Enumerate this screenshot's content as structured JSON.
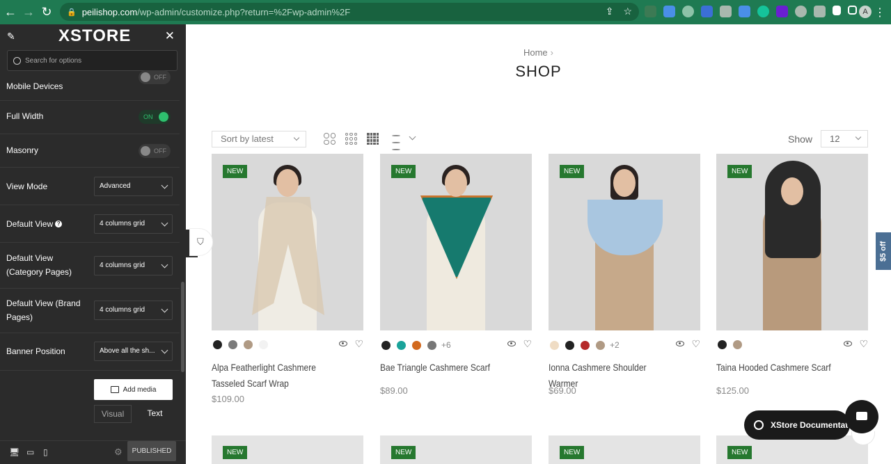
{
  "browser": {
    "url_host": "peilishop.com",
    "url_path": "/wp-admin/customize.php?return=%2Fwp-admin%2F",
    "avatar_letter": "A"
  },
  "sidebar": {
    "logo": "XSTORE",
    "search_placeholder": "Search for options",
    "options": [
      {
        "label": "Mobile Devices",
        "type": "toggle",
        "state": "OFF"
      },
      {
        "label": "Full Width",
        "type": "toggle",
        "state": "ON"
      },
      {
        "label": "Masonry",
        "type": "toggle",
        "state": "OFF"
      },
      {
        "label": "View Mode",
        "type": "select",
        "value": "Advanced"
      },
      {
        "label": "Default View",
        "type": "select",
        "value": "4 columns grid"
      },
      {
        "label": "Default View (Category Pages)",
        "type": "select",
        "value": "4 columns grid"
      },
      {
        "label": "Default View (Brand Pages)",
        "type": "select",
        "value": "4 columns grid"
      },
      {
        "label": "Banner Position",
        "type": "select",
        "value": "Above all the sh..."
      }
    ],
    "add_media": "Add media",
    "tab_visual": "Visual",
    "tab_text": "Text",
    "publish": "PUBLISHED"
  },
  "shop": {
    "breadcrumb": "Home",
    "title": "SHOP",
    "sort": "Sort by latest",
    "show_label": "Show",
    "show_value": "12",
    "badge": "NEW",
    "products": [
      {
        "name": "Alpa Featherlight Cashmere Tasseled Scarf Wrap",
        "price": "$109.00",
        "swatches": [
          "#222222",
          "#7a7a7a",
          "#b09a84",
          "#f2f2f2"
        ],
        "more": "",
        "accent": "#d8c7ae",
        "body": "#efece4"
      },
      {
        "name": "Bae Triangle Cashmere Scarf",
        "price": "$89.00",
        "swatches": [
          "#222222",
          "#1aa39a",
          "#d2691e",
          "#777777"
        ],
        "more": "+6",
        "accent": "#167a6e",
        "body": "#efeadf"
      },
      {
        "name": "Ionna Cashmere Shoulder Warmer",
        "price": "$69.00",
        "swatches": [
          "#efdcc4",
          "#222222",
          "#b52828",
          "#b09a84"
        ],
        "more": "+2",
        "accent": "#a9c6e0",
        "body": "#c6a98a"
      },
      {
        "name": "Taina Hooded Cashmere Scarf",
        "price": "$125.00",
        "swatches": [
          "#222222",
          "#b09a84"
        ],
        "more": "",
        "accent": "#2a2a2a",
        "body": "#b89a7c"
      }
    ]
  },
  "widgets": {
    "offer_tab": "$5 off",
    "doc_label": "XStore Documentat"
  }
}
